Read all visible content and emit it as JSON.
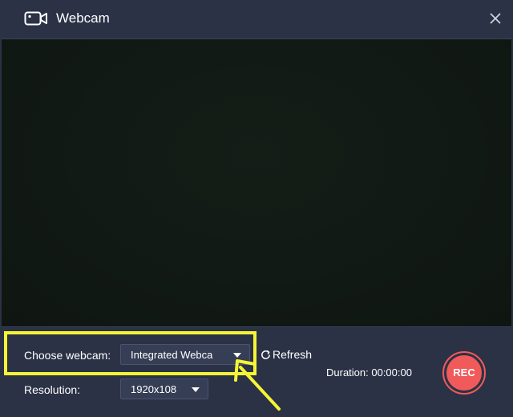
{
  "window": {
    "title": "Webcam",
    "title_icon": "video-camera-icon",
    "close_icon": "close-icon"
  },
  "controls": {
    "webcam_label": "Choose webcam:",
    "webcam_value": "Integrated Webca",
    "resolution_label": "Resolution:",
    "resolution_value": "1920x108",
    "refresh_label": "Refresh",
    "duration_text": "Duration: 00:00:00",
    "rec_label": "REC"
  },
  "colors": {
    "background": "#2b3246",
    "select_bg": "#363e55",
    "rec": "#f15a5a",
    "highlight": "#f5f536"
  }
}
